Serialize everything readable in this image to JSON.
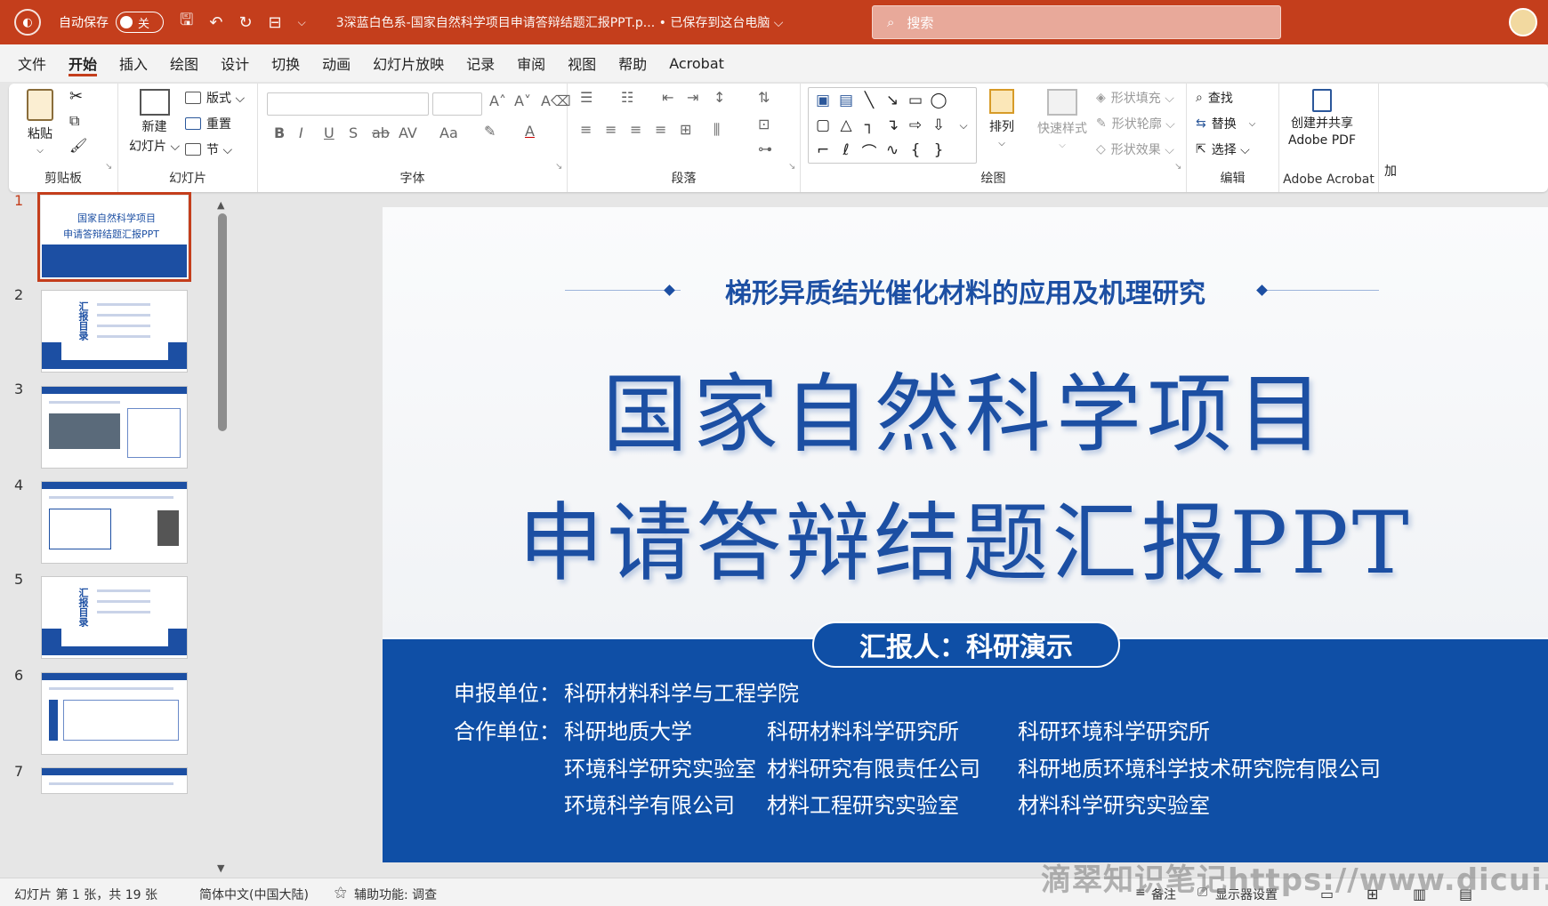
{
  "titlebar": {
    "autosave_label": "自动保存",
    "autosave_state": "关",
    "doc_title": "3深蓝白色系-国家自然科学项目申请答辩结题汇报PPT.p...  •  已保存到这台电脑 ⌵",
    "search_placeholder": "搜索"
  },
  "menu": {
    "tabs": [
      "文件",
      "开始",
      "插入",
      "绘图",
      "设计",
      "切换",
      "动画",
      "幻灯片放映",
      "记录",
      "审阅",
      "视图",
      "帮助",
      "Acrobat"
    ],
    "active_index": 1
  },
  "ribbon": {
    "clipboard": {
      "label": "剪贴板",
      "paste": "粘贴"
    },
    "slides": {
      "label": "幻灯片",
      "new_slide_1": "新建",
      "new_slide_2": "幻灯片 ⌵",
      "layout": "版式 ⌵",
      "reset": "重置",
      "section": "节 ⌵"
    },
    "font": {
      "label": "字体"
    },
    "paragraph": {
      "label": "段落"
    },
    "drawing": {
      "label": "绘图",
      "arrange": "排列",
      "quick_styles": "快速样式",
      "shape_fill": "形状填充 ⌵",
      "shape_outline": "形状轮廓 ⌵",
      "shape_effects": "形状效果 ⌵"
    },
    "editing": {
      "label": "编辑",
      "find": "查找",
      "replace": "替换",
      "select": "选择 ⌵"
    },
    "acrobat": {
      "label": "Adobe Acrobat",
      "create_1": "创建并共享",
      "create_2": "Adobe PDF",
      "extra": "加"
    }
  },
  "thumbnails": {
    "numbers": [
      "1",
      "2",
      "3",
      "4",
      "5",
      "6",
      "7"
    ],
    "slide1": {
      "line1": "国家自然科学项目",
      "line2": "申请答辩结题汇报PPT"
    },
    "toc_word": "汇报目录"
  },
  "slide": {
    "subtitle": "梯形异质结光催化材料的应用及机理研究",
    "title_line1": "国家自然科学项目",
    "title_line2": "申请答辩结题汇报PPT",
    "reporter": "汇报人：科研演示",
    "apply_label": "申报单位：",
    "apply_value": "科研材料科学与工程学院",
    "coop_label": "合作单位：",
    "coop_col1": [
      "科研地质大学",
      "环境科学研究实验室",
      "环境科学有限公司"
    ],
    "coop_col2": [
      "科研材料科学研究所",
      "材料研究有限责任公司",
      "材料工程研究实验室"
    ],
    "coop_col3": [
      "科研环境科学研究所",
      "科研地质环境科学技术研究院有限公司",
      "材料科学研究实验室"
    ]
  },
  "statusbar": {
    "slide_count": "幻灯片 第 1 张，共 19 张",
    "language": "简体中文(中国大陆)",
    "accessibility": "辅助功能: 调查",
    "notes": "备注",
    "display_settings": "显示器设置"
  },
  "watermark": "滴翠知识笔记https://www.dicui.cn",
  "colors": {
    "accent": "#c43e1c",
    "slide_blue": "#0f4fa6"
  }
}
